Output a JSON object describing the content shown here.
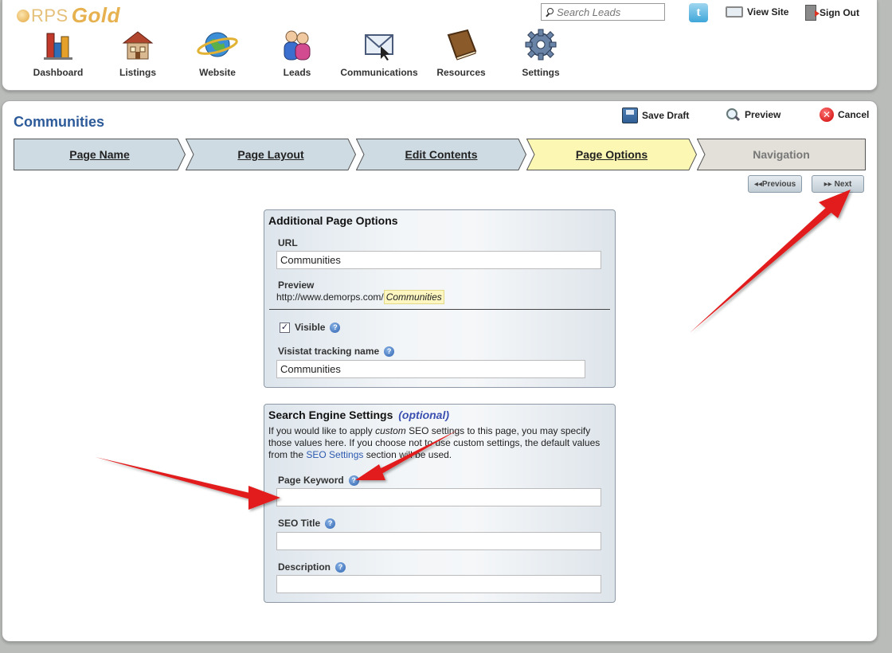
{
  "header": {
    "logo": {
      "brand": "RPS",
      "product": "Gold"
    },
    "search": {
      "placeholder": "Search Leads"
    },
    "view_site": "View Site",
    "sign_out": "Sign Out",
    "nav": [
      {
        "label": "Dashboard",
        "icon": "dashboard-icon"
      },
      {
        "label": "Listings",
        "icon": "listings-house-icon"
      },
      {
        "label": "Website",
        "icon": "website-globe-icon"
      },
      {
        "label": "Leads",
        "icon": "leads-people-icon"
      },
      {
        "label": "Communications",
        "icon": "communications-envelope-icon"
      },
      {
        "label": "Resources",
        "icon": "resources-book-icon"
      },
      {
        "label": "Settings",
        "icon": "settings-gear-icon"
      }
    ]
  },
  "page": {
    "title": "Communities",
    "toolbar": {
      "save_draft": "Save Draft",
      "preview": "Preview",
      "cancel": "Cancel"
    },
    "steps": [
      {
        "label": "Page Name",
        "state": "done"
      },
      {
        "label": "Page Layout",
        "state": "done"
      },
      {
        "label": "Edit Contents",
        "state": "done"
      },
      {
        "label": "Page Options",
        "state": "current"
      },
      {
        "label": "Navigation",
        "state": "disabled"
      }
    ],
    "pager": {
      "previous": "Previous",
      "next": "Next"
    }
  },
  "additional_options": {
    "title": "Additional Page Options",
    "url_label": "URL",
    "url_value": "Communities",
    "preview_label": "Preview",
    "preview_base": "http://www.demorps.com/",
    "preview_slug": "Communities",
    "visible_label": "Visible",
    "visible_checked": true,
    "tracking_label": "Visistat tracking name",
    "tracking_value": "Communities"
  },
  "seo": {
    "title": "Search Engine Settings",
    "optional": "(optional)",
    "desc_part1": "If you would like to apply ",
    "desc_em": "custom",
    "desc_part2": " SEO settings to this page, you may specify those values here. If you choose not to use custom settings, the default values from the ",
    "desc_link": "SEO Settings",
    "desc_part3": " section will be used.",
    "keyword_label": "Page Keyword",
    "keyword_value": "",
    "seo_title_label": "SEO Title",
    "seo_title_value": "",
    "description_label": "Description",
    "description_value": ""
  },
  "colors": {
    "title_blue": "#2d5b9a",
    "step_done": "#cfdbe3",
    "step_current": "#fdf7b4",
    "step_disabled": "#e2e0d8",
    "arrow_red": "#e21b1b"
  }
}
